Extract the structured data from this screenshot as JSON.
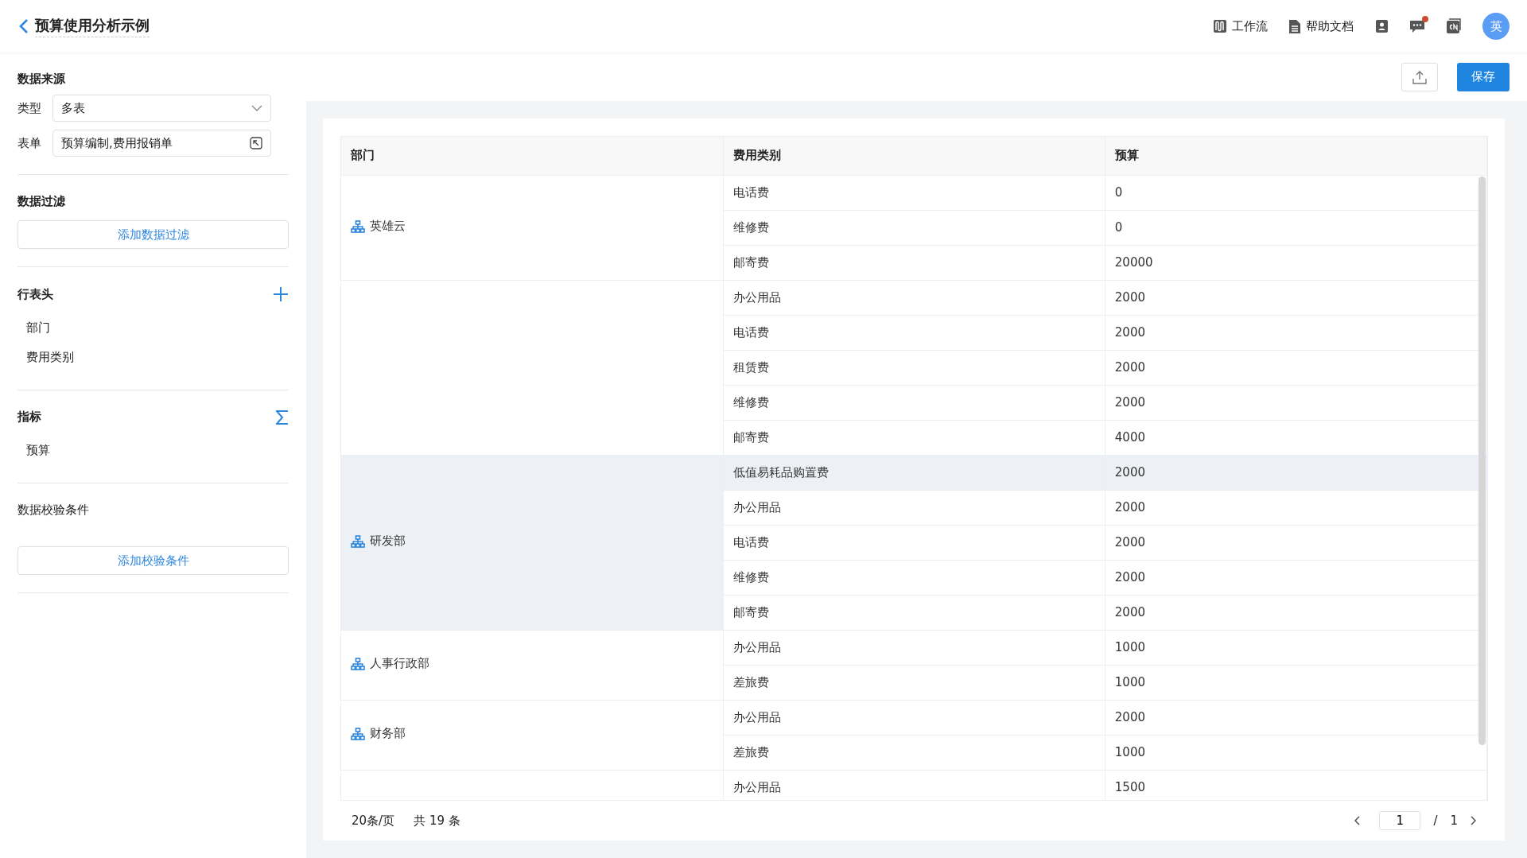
{
  "header": {
    "title": "预算使用分析示例",
    "links": [
      {
        "kind": "workflow",
        "label": "工作流"
      },
      {
        "kind": "docs",
        "label": "帮助文档"
      }
    ],
    "notification_dot": true,
    "avatar": "英"
  },
  "sidebar": {
    "source": {
      "title": "数据来源",
      "type_label": "类型",
      "type_value": "多表",
      "form_label": "表单",
      "form_value": "预算编制,费用报销单"
    },
    "filter": {
      "title": "数据过滤",
      "button": "添加数据过滤"
    },
    "row_headers": {
      "title": "行表头",
      "items": [
        "部门",
        "费用类别"
      ]
    },
    "metrics": {
      "title": "指标",
      "items": [
        "预算"
      ]
    },
    "validation": {
      "title": "数据校验条件",
      "button": "添加校验条件"
    }
  },
  "toolbar": {
    "save": "保存"
  },
  "table": {
    "columns": [
      "部门",
      "费用类别",
      "预算"
    ],
    "groups": [
      {
        "department": "英雄云",
        "highlighted": false,
        "rows": [
          {
            "category": "电话费",
            "budget": "0",
            "highlighted": false
          },
          {
            "category": "维修费",
            "budget": "0",
            "highlighted": false
          },
          {
            "category": "邮寄费",
            "budget": "20000",
            "highlighted": false
          }
        ]
      },
      {
        "highlighted": false,
        "rows": [
          {
            "category": "办公用品",
            "budget": "2000",
            "highlighted": false
          },
          {
            "category": "电话费",
            "budget": "2000",
            "highlighted": false
          },
          {
            "category": "租赁费",
            "budget": "2000",
            "highlighted": false
          },
          {
            "category": "维修费",
            "budget": "2000",
            "highlighted": false
          },
          {
            "category": "邮寄费",
            "budget": "4000",
            "highlighted": false
          }
        ]
      },
      {
        "department": "研发部",
        "highlighted": true,
        "rows": [
          {
            "category": "低值易耗品购置费",
            "budget": "2000",
            "highlighted": true
          },
          {
            "category": "办公用品",
            "budget": "2000",
            "highlighted": false
          },
          {
            "category": "电话费",
            "budget": "2000",
            "highlighted": false
          },
          {
            "category": "维修费",
            "budget": "2000",
            "highlighted": false
          },
          {
            "category": "邮寄费",
            "budget": "2000",
            "highlighted": false
          }
        ]
      },
      {
        "department": "人事行政部",
        "highlighted": false,
        "rows": [
          {
            "category": "办公用品",
            "budget": "1000",
            "highlighted": false
          },
          {
            "category": "差旅费",
            "budget": "1000",
            "highlighted": false
          }
        ]
      },
      {
        "department": "财务部",
        "highlighted": false,
        "rows": [
          {
            "category": "办公用品",
            "budget": "2000",
            "highlighted": false
          },
          {
            "category": "差旅费",
            "budget": "1000",
            "highlighted": false
          }
        ]
      },
      {
        "highlighted": false,
        "rows": [
          {
            "category": "办公用品",
            "budget": "1500",
            "highlighted": false
          }
        ]
      }
    ]
  },
  "pagination": {
    "page_size": "20条/页",
    "total": "共 19 条",
    "page": "1",
    "separator": "/",
    "pages": "1"
  }
}
